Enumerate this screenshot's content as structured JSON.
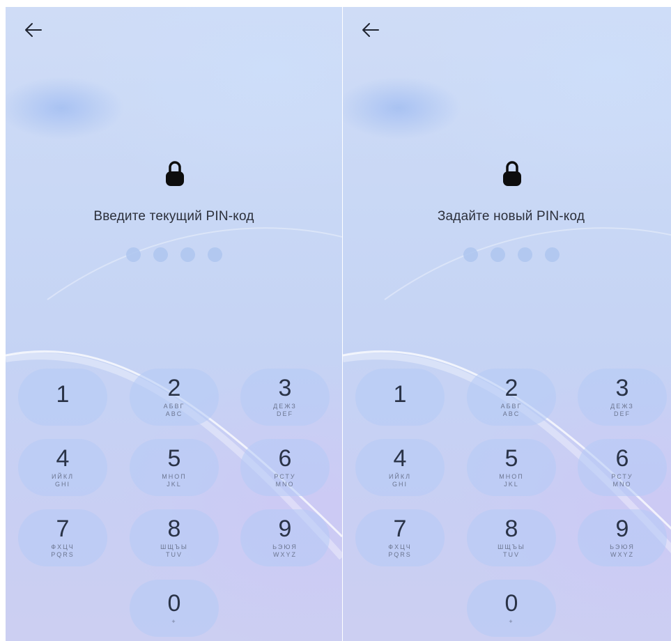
{
  "screens": [
    {
      "title": "Введите текущий PIN-код",
      "back_icon": "arrow-left-icon",
      "lock_icon": "lock-icon",
      "pin_length": 4,
      "keys": [
        {
          "num": "1",
          "l1": "",
          "l2": ""
        },
        {
          "num": "2",
          "l1": "АБВГ",
          "l2": "ABC"
        },
        {
          "num": "3",
          "l1": "ДЕЖЗ",
          "l2": "DEF"
        },
        {
          "num": "4",
          "l1": "ИЙКЛ",
          "l2": "GHI"
        },
        {
          "num": "5",
          "l1": "МНОП",
          "l2": "JKL"
        },
        {
          "num": "6",
          "l1": "РСТУ",
          "l2": "MNO"
        },
        {
          "num": "7",
          "l1": "ФХЦЧ",
          "l2": "PQRS"
        },
        {
          "num": "8",
          "l1": "ШЩЪЫ",
          "l2": "TUV"
        },
        {
          "num": "9",
          "l1": "ЬЭЮЯ",
          "l2": "WXYZ"
        },
        {
          "num": "0",
          "l1": "+",
          "l2": ""
        }
      ]
    },
    {
      "title": "Задайте новый PIN-код",
      "back_icon": "arrow-left-icon",
      "lock_icon": "lock-icon",
      "pin_length": 4,
      "keys": [
        {
          "num": "1",
          "l1": "",
          "l2": ""
        },
        {
          "num": "2",
          "l1": "АБВГ",
          "l2": "ABC"
        },
        {
          "num": "3",
          "l1": "ДЕЖЗ",
          "l2": "DEF"
        },
        {
          "num": "4",
          "l1": "ИЙКЛ",
          "l2": "GHI"
        },
        {
          "num": "5",
          "l1": "МНОП",
          "l2": "JKL"
        },
        {
          "num": "6",
          "l1": "РСТУ",
          "l2": "MNO"
        },
        {
          "num": "7",
          "l1": "ФХЦЧ",
          "l2": "PQRS"
        },
        {
          "num": "8",
          "l1": "ШЩЪЫ",
          "l2": "TUV"
        },
        {
          "num": "9",
          "l1": "ЬЭЮЯ",
          "l2": "WXYZ"
        },
        {
          "num": "0",
          "l1": "+",
          "l2": ""
        }
      ]
    }
  ],
  "colors": {
    "background": "#c8d7f5",
    "key_fill": "#b4caf5",
    "dot_fill": "#afc6f0",
    "text": "#2b2f3a"
  }
}
